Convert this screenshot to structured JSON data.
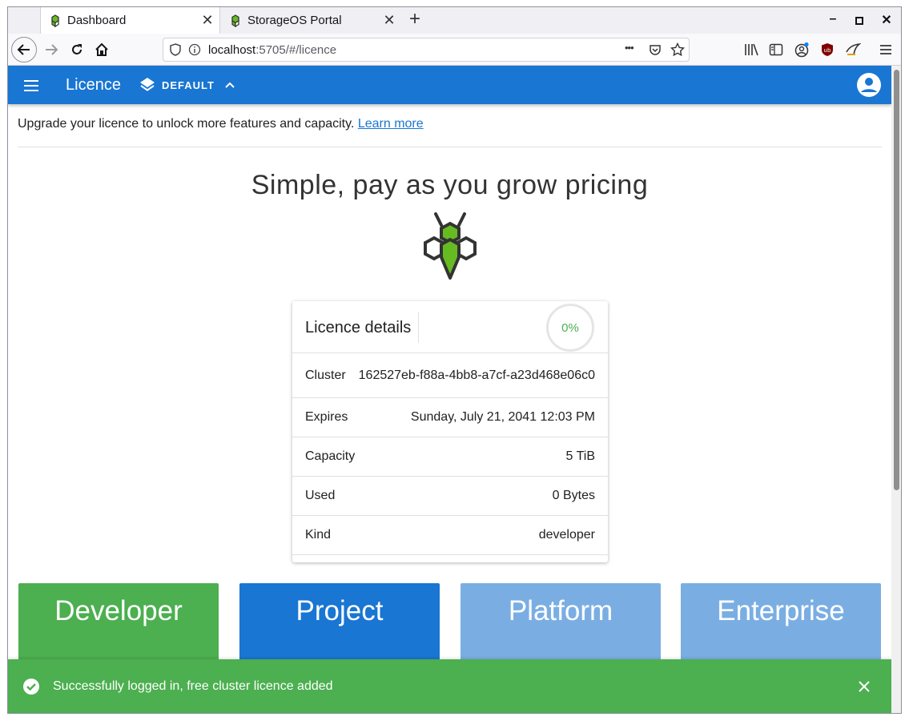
{
  "browser": {
    "tabs": [
      {
        "label": "Dashboard",
        "active": true
      },
      {
        "label": "StorageOS Portal",
        "active": false
      }
    ],
    "url_host": "localhost",
    "url_rest": ":5705/#/licence",
    "url_more": "•••"
  },
  "appbar": {
    "title": "Licence",
    "namespace": "DEFAULT",
    "color": "#1976d2"
  },
  "upgrade": {
    "text": "Upgrade your licence to unlock more features and capacity.",
    "link": "Learn more"
  },
  "heading": "Simple, pay as you grow pricing",
  "licence_card": {
    "title": "Licence details",
    "usage_percent_label": "0%",
    "rows": [
      {
        "label": "Cluster",
        "value": "162527eb-f88a-4bb8-a7cf-a23d468e06c0"
      },
      {
        "label": "Expires",
        "value": "Sunday, July 21, 2041 12:03 PM"
      },
      {
        "label": "Capacity",
        "value": "5 TiB"
      },
      {
        "label": "Used",
        "value": "0 Bytes"
      },
      {
        "label": "Kind",
        "value": "developer"
      }
    ]
  },
  "plans": [
    {
      "name": "Developer",
      "color": "#4caf50"
    },
    {
      "name": "Project",
      "color": "#1976d2"
    },
    {
      "name": "Platform",
      "color": "#7aaee3"
    },
    {
      "name": "Enterprise",
      "color": "#7aaee3"
    }
  ],
  "snackbar": {
    "message": "Successfully logged in, free cluster licence added",
    "color": "#4caf50"
  }
}
